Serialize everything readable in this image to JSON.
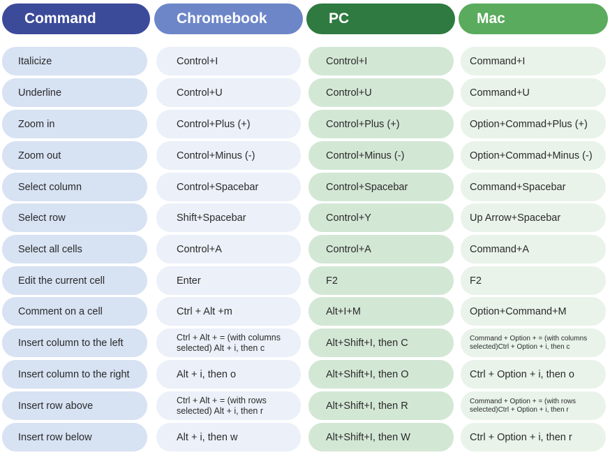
{
  "headers": {
    "command": "Command",
    "chromebook": "Chromebook",
    "pc": "PC",
    "mac": "Mac"
  },
  "rows": [
    {
      "command": "Italicize",
      "chromebook": "Control+I",
      "pc": "Control+I",
      "mac": "Command+I"
    },
    {
      "command": "Underline",
      "chromebook": "Control+U",
      "pc": "Control+U",
      "mac": "Command+U"
    },
    {
      "command": "Zoom in",
      "chromebook": "Control+Plus (+)",
      "pc": "Control+Plus (+)",
      "mac": "Option+Commad+Plus (+)"
    },
    {
      "command": "Zoom out",
      "chromebook": "Control+Minus (-)",
      "pc": "Control+Minus (-)",
      "mac": "Option+Commad+Minus (-)"
    },
    {
      "command": "Select column",
      "chromebook": "Control+Spacebar",
      "pc": "Control+Spacebar",
      "mac": "Command+Spacebar"
    },
    {
      "command": "Select row",
      "chromebook": "Shift+Spacebar",
      "pc": "Control+Y",
      "mac": "Up Arrow+Spacebar"
    },
    {
      "command": "Select all cells",
      "chromebook": "Control+A",
      "pc": "Control+A",
      "mac": "Command+A"
    },
    {
      "command": "Edit the current cell",
      "chromebook": "Enter",
      "pc": "F2",
      "mac": "F2"
    },
    {
      "command": "Comment on a cell",
      "chromebook": "Ctrl + Alt +m",
      "pc": "Alt+I+M",
      "mac": "Option+Command+M"
    },
    {
      "command": "Insert column to the left",
      "chromebook": "Ctrl + Alt + = (with columns selected) Alt + i, then c",
      "pc": "Alt+Shift+I, then C",
      "mac": "Command + Option + = (with columns selected)Ctrl + Option + i, then c"
    },
    {
      "command": "Insert column to the right",
      "chromebook": "Alt + i, then o",
      "pc": "Alt+Shift+I, then O",
      "mac": "Ctrl + Option + i, then o"
    },
    {
      "command": "Insert row above",
      "chromebook": "Ctrl + Alt + = (with rows selected) Alt + i, then r",
      "pc": "Alt+Shift+I, then R",
      "mac": "Command + Option + = (with rows selected)Ctrl + Option + i, then r"
    },
    {
      "command": "Insert row below",
      "chromebook": "Alt + i, then w",
      "pc": "Alt+Shift+I, then W",
      "mac": "Ctrl + Option + i, then r"
    }
  ]
}
